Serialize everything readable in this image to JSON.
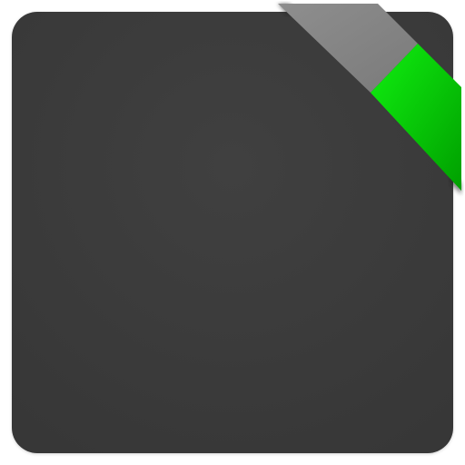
{
  "icon": {
    "name": "square-tile-with-corner-ribbon",
    "colors": {
      "tile": "#3b3b3b",
      "tile_highlight": "#404040",
      "tile_shadow": "#373737",
      "ribbon_gray_light": "#8e8e8e",
      "ribbon_gray_dark": "#7a7a7a",
      "ribbon_green_light": "#10f010",
      "ribbon_green_dark": "#009f00",
      "ribbon_fold_shadow": "#1e1e1e"
    },
    "ribbon_fill_fraction": 0.5
  }
}
